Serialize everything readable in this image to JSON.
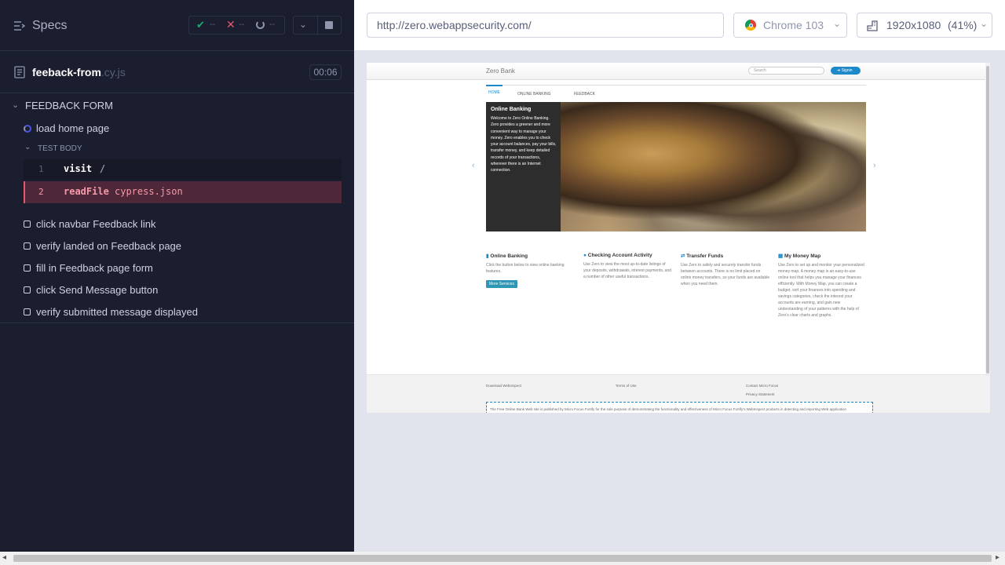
{
  "specs": {
    "title": "Specs",
    "stats": {
      "passed": "--",
      "failed": "--",
      "pending": "--"
    }
  },
  "spec_file": {
    "name": "feeback-from",
    "ext": ".cy.js",
    "duration": "00:06"
  },
  "suite": {
    "title": "FEEDBACK FORM",
    "tests": [
      {
        "title": "load home page",
        "state": "running"
      },
      {
        "title": "click navbar Feedback link",
        "state": "pending"
      },
      {
        "title": "verify landed on Feedback page",
        "state": "pending"
      },
      {
        "title": "fill in Feedback page form",
        "state": "pending"
      },
      {
        "title": "click Send Message button",
        "state": "pending"
      },
      {
        "title": "verify submitted message displayed",
        "state": "pending"
      }
    ],
    "test_body": {
      "label": "TEST BODY",
      "commands": [
        {
          "num": "1",
          "name": "visit",
          "arg": "/"
        },
        {
          "num": "2",
          "name": "readFile",
          "arg": "cypress.json"
        }
      ]
    }
  },
  "toolbar": {
    "url": "http://zero.webappsecurity.com/",
    "browser": "Chrome 103",
    "viewport": "1920x1080",
    "scale": "(41%)"
  },
  "aut": {
    "brand": "Zero Bank",
    "search_placeholder": "Search",
    "signin": "Signin",
    "nav": [
      "HOME",
      "ONLINE BANKING",
      "FEEDBACK"
    ],
    "hero": {
      "title": "Online Banking",
      "text": "Welcome to Zero Online Banking. Zero provides a greener and more convenient way to manage your money. Zero enables you to check your account balances, pay your bills, transfer money, and keep detailed records of your transactions, wherever there is an Internet connection."
    },
    "features": [
      {
        "title": "Online Banking",
        "text": "Click the button below to view online banking features.",
        "button": "More Services"
      },
      {
        "title": "Checking Account Activity",
        "text": "Use Zero to view the most up-to-date listings of your deposits, withdrawals, interest payments, and a number of other useful transactions."
      },
      {
        "title": "Transfer Funds",
        "text": "Use Zero to safely and securely transfer funds between accounts. There is no limit placed on online money transfers, so your funds are available when you need them."
      },
      {
        "title": "My Money Map",
        "text": "Use Zero to set up and monitor your personalized money map. A money map is an easy-to-use online tool that helps you manage your finances efficiently. With Money Map, you can create a budget, sort your finances into spending and savings categories, check the interest your accounts are earning, and gain new understanding of your patterns with the help of Zero's clear charts and graphs."
      }
    ],
    "footer": {
      "links": [
        "Download WebInspect",
        "Terms of Use",
        "Contact Micro Focus",
        "Privacy Statement"
      ],
      "disclaimer": "The Free Online Bank Web site is published by Micro Focus Fortify for the sole purpose of demonstrating the functionality and effectiveness of Micro Focus Fortify's WebInspect products in detecting and reporting Web application"
    }
  },
  "colors": {
    "panel": "#1b1e2e",
    "fail": "#e45770",
    "pass": "#1fa971",
    "accent": "#4956e3",
    "aut_dark": "#2d2d2d",
    "aut_blue": "#1e89c9"
  }
}
